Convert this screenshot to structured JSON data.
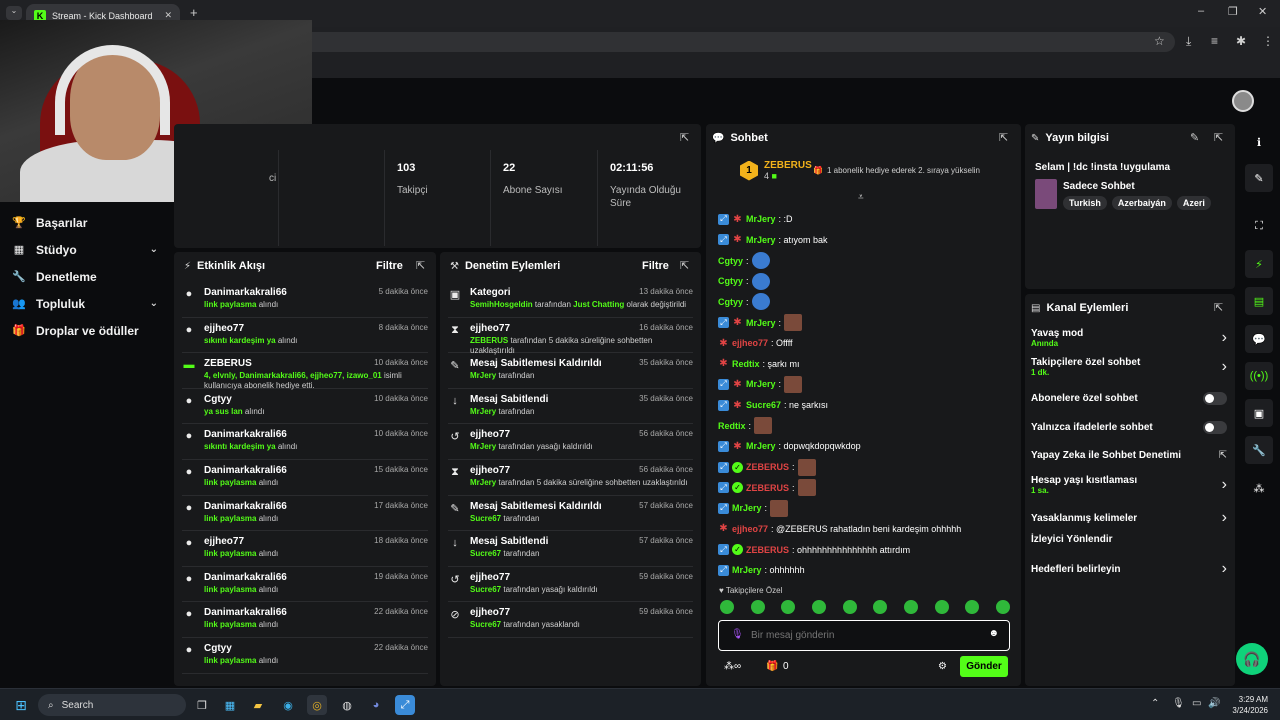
{
  "browser": {
    "tab_title": "Stream - Kick Dashboard",
    "min": "–",
    "max": "❐",
    "close": "✕"
  },
  "nav": [
    {
      "icon": "🏆",
      "label": "Başarılar",
      "chev": ""
    },
    {
      "icon": "▦",
      "label": "Stüdyo",
      "chev": "⌄"
    },
    {
      "icon": "🔧",
      "label": "Denetleme",
      "chev": ""
    },
    {
      "icon": "👥",
      "label": "Topluluk",
      "chev": "⌄"
    },
    {
      "icon": "🎁",
      "label": "Droplar ve ödüller",
      "chev": ""
    }
  ],
  "stats": {
    "partial": "ci",
    "items": [
      {
        "value": "103",
        "label": "Takipçi"
      },
      {
        "value": "22",
        "label": "Abone Sayısı"
      },
      {
        "value": "02:11:56",
        "label": "Yayında Olduğu Süre"
      }
    ]
  },
  "activity": {
    "title": "Etkinlik Akışı",
    "filter": "Filtre",
    "rows": [
      {
        "icon": "●",
        "name": "Danimarkakrali66",
        "time": "5 dakika önce",
        "hl": "link paylasma",
        "rest": " alındı"
      },
      {
        "icon": "●",
        "name": "ejjheo77",
        "time": "8 dakika önce",
        "hl": "sıkıntı kardeşim ya",
        "rest": " alındı"
      },
      {
        "icon": "▬",
        "name": "ZEBERUS",
        "time": "10 dakika önce",
        "hl": "4, elvnly, Danimarkakrali66, ejjheo77, izawo_01",
        "rest": " isimli kullanıcıya abonelik hediye etti."
      },
      {
        "icon": "●",
        "name": "Cgtyy",
        "time": "10 dakika önce",
        "hl": "ya sus lan",
        "rest": " alındı"
      },
      {
        "icon": "●",
        "name": "Danimarkakrali66",
        "time": "10 dakika önce",
        "hl": "sıkıntı kardeşim ya",
        "rest": " alındı"
      },
      {
        "icon": "●",
        "name": "Danimarkakrali66",
        "time": "15 dakika önce",
        "hl": "link paylasma",
        "rest": " alındı"
      },
      {
        "icon": "●",
        "name": "Danimarkakrali66",
        "time": "17 dakika önce",
        "hl": "link paylasma",
        "rest": " alındı"
      },
      {
        "icon": "●",
        "name": "ejjheo77",
        "time": "18 dakika önce",
        "hl": "link paylasma",
        "rest": " alındı"
      },
      {
        "icon": "●",
        "name": "Danimarkakrali66",
        "time": "19 dakika önce",
        "hl": "link paylasma",
        "rest": " alındı"
      },
      {
        "icon": "●",
        "name": "Danimarkakrali66",
        "time": "22 dakika önce",
        "hl": "link paylasma",
        "rest": " alındı"
      },
      {
        "icon": "●",
        "name": "Cgtyy",
        "time": "22 dakika önce",
        "hl": "link paylasma",
        "rest": " alındı"
      }
    ]
  },
  "moderation": {
    "title": "Denetim Eylemleri",
    "filter": "Filtre",
    "rows": [
      {
        "icon": "▣",
        "name": "Kategori",
        "time": "13 dakika önce",
        "hl": "SemihHosgeldin",
        "rest": " tarafından ",
        "hl2": "Just Chatting",
        "rest2": " olarak değiştirildi"
      },
      {
        "icon": "⧗",
        "name": "ejjheo77",
        "time": "16 dakika önce",
        "hl": "ZEBERUS",
        "rest": " tarafından 5 dakika süreliğine sohbetten uzaklaştırıldı",
        "hl2": "",
        "rest2": ""
      },
      {
        "icon": "✎",
        "name": "Mesaj Sabitlemesi Kaldırıldı",
        "time": "35 dakika önce",
        "hl": "MrJery",
        "rest": " tarafından",
        "hl2": "",
        "rest2": ""
      },
      {
        "icon": "↓",
        "name": "Mesaj Sabitlendi",
        "time": "35 dakika önce",
        "hl": "MrJery",
        "rest": " tarafından",
        "hl2": "",
        "rest2": ""
      },
      {
        "icon": "↺",
        "name": "ejjheo77",
        "time": "56 dakika önce",
        "hl": "MrJery",
        "rest": " tarafından yasağı kaldırıldı",
        "hl2": "",
        "rest2": ""
      },
      {
        "icon": "⧗",
        "name": "ejjheo77",
        "time": "56 dakika önce",
        "hl": "MrJery",
        "rest": " tarafından 5 dakika süreliğine sohbetten uzaklaştırıldı",
        "hl2": "",
        "rest2": ""
      },
      {
        "icon": "✎",
        "name": "Mesaj Sabitlemesi Kaldırıldı",
        "time": "57 dakika önce",
        "hl": "Sucre67",
        "rest": " tarafından",
        "hl2": "",
        "rest2": ""
      },
      {
        "icon": "↓",
        "name": "Mesaj Sabitlendi",
        "time": "57 dakika önce",
        "hl": "Sucre67",
        "rest": " tarafından",
        "hl2": "",
        "rest2": ""
      },
      {
        "icon": "↺",
        "name": "ejjheo77",
        "time": "59 dakika önce",
        "hl": "Sucre67",
        "rest": " tarafından yasağı kaldırıldı",
        "hl2": "",
        "rest2": ""
      },
      {
        "icon": "⊘",
        "name": "ejjheo77",
        "time": "59 dakika önce",
        "hl": "Sucre67",
        "rest": " tarafından yasaklandı",
        "hl2": "",
        "rest2": ""
      }
    ]
  },
  "chat": {
    "title": "Sohbet",
    "top_rank": "1",
    "top_user": "ZEBERUS",
    "top_count": "4",
    "gift_prompt": "1 abonelik hediye ederek 2. sıraya yükselin",
    "messages": [
      {
        "badges": [
          "b1",
          "b2"
        ],
        "user": "MrJery",
        "color": "#53fc18",
        "text": ": :D",
        "emote": ""
      },
      {
        "badges": [
          "b1",
          "b2"
        ],
        "user": "MrJery",
        "color": "#53fc18",
        "text": ": atıyom bak",
        "emote": ""
      },
      {
        "badges": [],
        "user": "Cgtyy",
        "color": "#53fc18",
        "text": ":",
        "emote": "blue"
      },
      {
        "badges": [],
        "user": "Cgtyy",
        "color": "#53fc18",
        "text": ":",
        "emote": "blue"
      },
      {
        "badges": [],
        "user": "Cgtyy",
        "color": "#53fc18",
        "text": ":",
        "emote": "blue"
      },
      {
        "badges": [
          "b1",
          "b2"
        ],
        "user": "MrJery",
        "color": "#53fc18",
        "text": ":",
        "emote": "brown"
      },
      {
        "badges": [
          "b2"
        ],
        "user": "ejjheo77",
        "color": "#e04444",
        "text": ": Offff",
        "emote": ""
      },
      {
        "badges": [
          "b2"
        ],
        "user": "Redtix",
        "color": "#53fc18",
        "text": ": şarkı mı",
        "emote": ""
      },
      {
        "badges": [
          "b1",
          "b2"
        ],
        "user": "MrJery",
        "color": "#53fc18",
        "text": ":",
        "emote": "brown"
      },
      {
        "badges": [
          "b1",
          "b2"
        ],
        "user": "Sucre67",
        "color": "#53fc18",
        "text": ": ne şarkısı",
        "emote": ""
      },
      {
        "badges": [],
        "user": "Redtix",
        "color": "#53fc18",
        "text": ":",
        "emote": "brown"
      },
      {
        "badges": [
          "b1",
          "b2"
        ],
        "user": "MrJery",
        "color": "#53fc18",
        "text": ": dopwqkdopqwkdop",
        "emote": ""
      },
      {
        "badges": [
          "b1",
          "b3"
        ],
        "user": "ZEBERUS",
        "color": "#e04444",
        "text": ":",
        "emote": "brown"
      },
      {
        "badges": [
          "b1",
          "b3"
        ],
        "user": "ZEBERUS",
        "color": "#e04444",
        "text": ":",
        "emote": "brown"
      },
      {
        "badges": [
          "b1"
        ],
        "user": "MrJery",
        "color": "#53fc18",
        "text": ":",
        "emote": "brown"
      },
      {
        "badges": [
          "b2"
        ],
        "user": "ejjheo77",
        "color": "#e04444",
        "text": ": @ZEBERUS rahatladın beni kardeşim ohhhhh",
        "emote": ""
      },
      {
        "badges": [
          "b1",
          "b3"
        ],
        "user": "ZEBERUS",
        "color": "#e04444",
        "text": ": ohhhhhhhhhhhhhhh attırdım",
        "emote": ""
      },
      {
        "badges": [
          "b1"
        ],
        "user": "MrJery",
        "color": "#53fc18",
        "text": ": ohhhhhh",
        "emote": ""
      }
    ],
    "followers_only": "Takipçilere Özel",
    "placeholder": "Bir mesaj gönderin",
    "points": "0",
    "send": "Gönder"
  },
  "info": {
    "title": "Yayın bilgisi",
    "stream_title": "Selam | !dc !insta !uygulama",
    "category": "Sadece Sohbet",
    "tags": [
      "Turkish",
      "Azerbaiyán",
      "Azeri"
    ]
  },
  "channel_actions": {
    "title": "Kanal Eylemleri",
    "rows": [
      {
        "label": "Yavaş mod",
        "sub": "Anında",
        "ctrl": "chev"
      },
      {
        "label": "Takipçilere özel sohbet",
        "sub": "1 dk.",
        "ctrl": "chev"
      },
      {
        "label": "Abonelere özel sohbet",
        "sub": "",
        "ctrl": "toggle"
      },
      {
        "label": "Yalnızca ifadelerle sohbet",
        "sub": "",
        "ctrl": "toggle"
      },
      {
        "label": "Yapay Zeka ile Sohbet Denetimi",
        "sub": "",
        "ctrl": "ext"
      },
      {
        "label": "Hesap yaşı kısıtlaması",
        "sub": "1 sa.",
        "ctrl": "chev"
      },
      {
        "label": "Yasaklanmış kelimeler",
        "sub": "",
        "ctrl": "chev"
      },
      {
        "label": "İzleyici Yönlendir",
        "sub": "",
        "ctrl": ""
      },
      {
        "label": "Hedefleri belirleyin",
        "sub": "",
        "ctrl": "chev"
      }
    ]
  },
  "taskbar": {
    "search": "Search",
    "time": "3:29 AM",
    "date": "3/24/2026"
  }
}
